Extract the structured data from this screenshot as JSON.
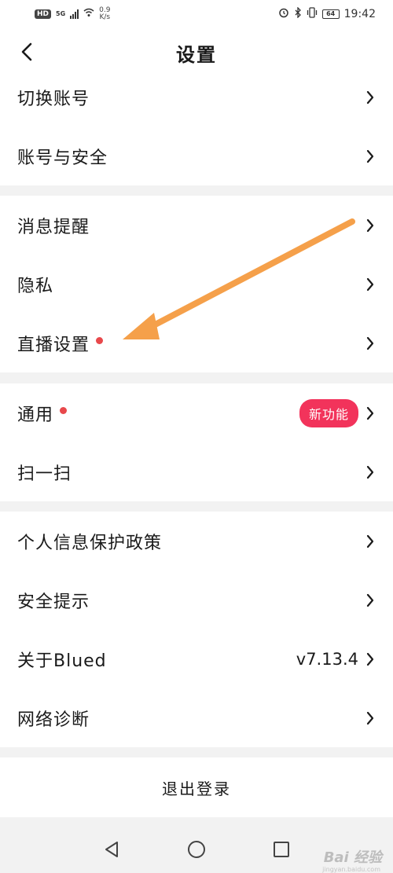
{
  "status_bar": {
    "hd": "HD",
    "network": "5G",
    "speed_value": "0.9",
    "speed_unit": "K/s",
    "battery": "64",
    "time": "19:42"
  },
  "header": {
    "title": "设置",
    "back_icon": "chevron-left-icon"
  },
  "groups": [
    {
      "items": [
        {
          "label": "切换账号"
        },
        {
          "label": "账号与安全"
        }
      ]
    },
    {
      "items": [
        {
          "label": "消息提醒"
        },
        {
          "label": "隐私"
        },
        {
          "label": "直播设置",
          "dot": true
        }
      ]
    },
    {
      "items": [
        {
          "label": "通用",
          "dot": true,
          "badge": "新功能"
        },
        {
          "label": "扫一扫"
        }
      ]
    },
    {
      "items": [
        {
          "label": "个人信息保护政策"
        },
        {
          "label": "安全提示"
        },
        {
          "label": "关于Blued",
          "value": "v7.13.4"
        },
        {
          "label": "网络诊断"
        }
      ]
    }
  ],
  "logout": {
    "label": "退出登录"
  },
  "nav_bar": {
    "back_icon": "triangle-back-icon",
    "home_icon": "circle-home-icon",
    "recent_icon": "square-recent-icon"
  },
  "watermark": {
    "text": "Bai 经验",
    "sub": "jingyan.baidu.com"
  },
  "colors": {
    "dot": "#e8484b",
    "badge": "#f2335b",
    "arrow": "#f5a04a"
  }
}
